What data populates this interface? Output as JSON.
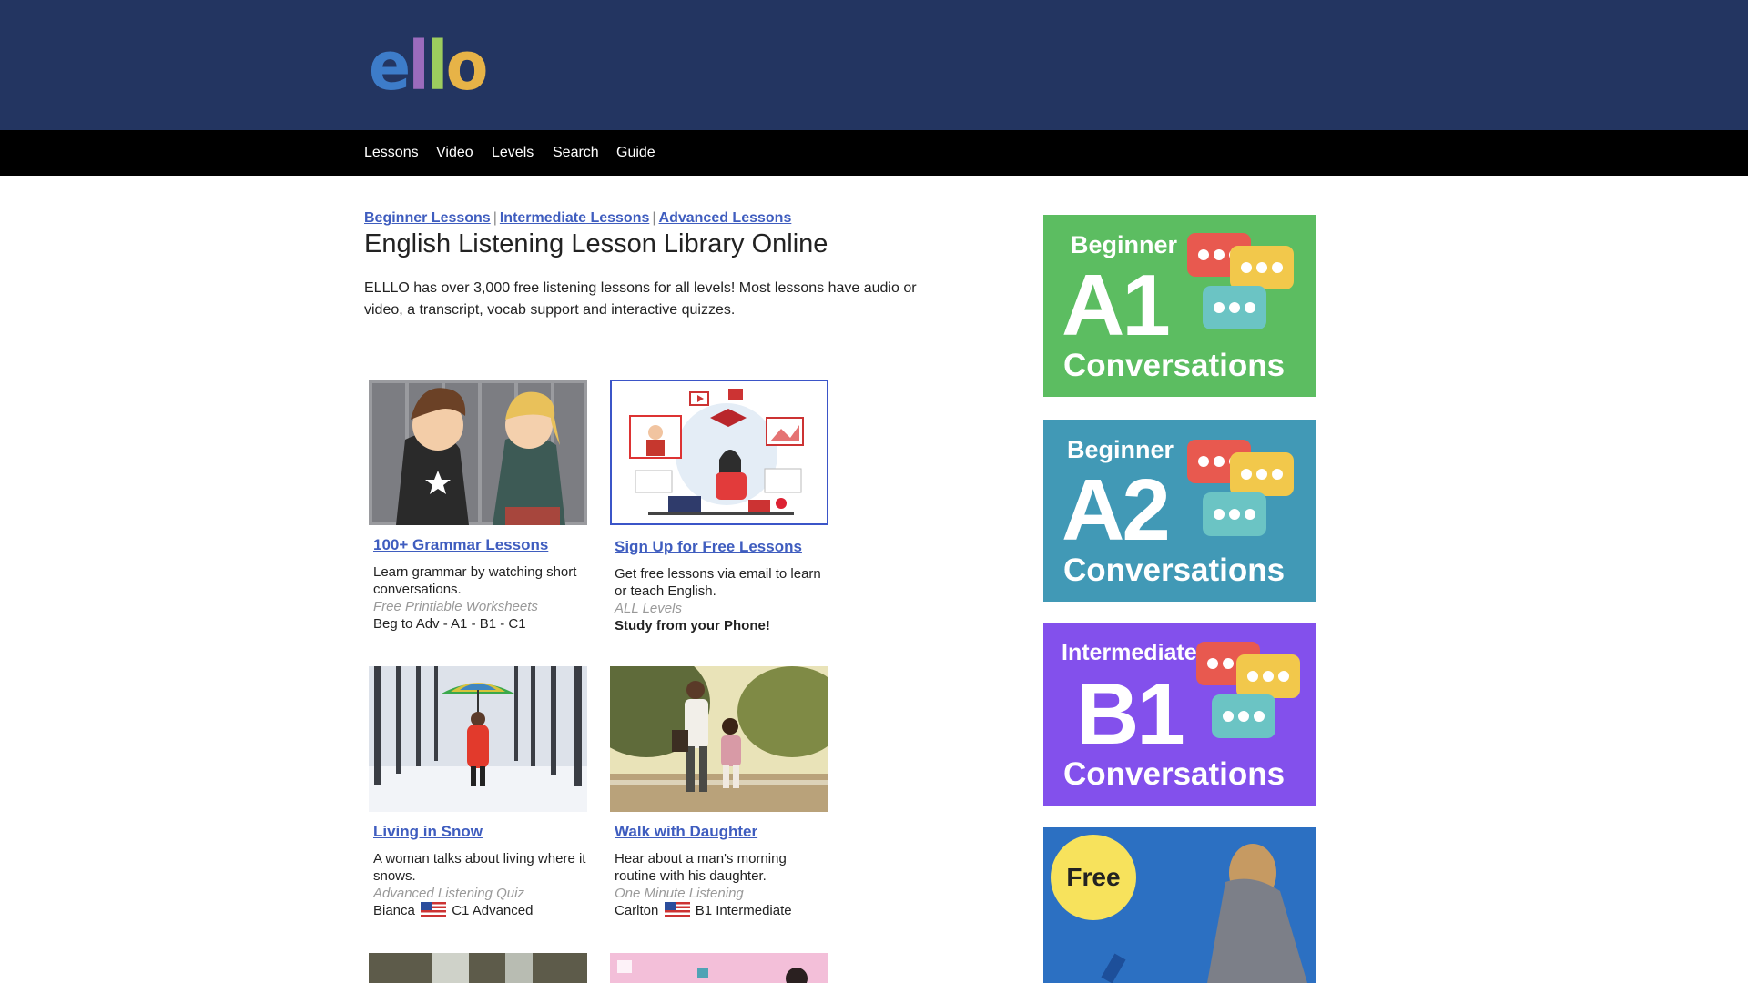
{
  "logo": {
    "text_e": "e",
    "text_l1": "l",
    "text_l2": "l",
    "text_o": "o"
  },
  "nav": [
    "Lessons",
    "Video",
    "Levels",
    "Search",
    "Guide"
  ],
  "breadcrumbs": {
    "beginner": "Beginner Lessons",
    "intermediate": "Intermediate Lessons",
    "advanced": "Advanced Lessons",
    "separator": "|"
  },
  "page_title": "English Listening Lesson Library Online",
  "intro": "ELLLO has over 3,000 free listening lessons for all levels! Most lessons have audio or video, a transcript, vocab support and interactive quizzes.",
  "cards": [
    {
      "title": "100+ Grammar Lessons",
      "desc": "Learn grammar by watching short conversations.",
      "tag": "Free Printiable Worksheets",
      "foot": "Beg to Adv - A1 - B1 - C1"
    },
    {
      "title": "Sign Up for Free Lessons",
      "desc": "Get free lessons via email to learn or teach English.",
      "tag": "ALL Levels",
      "foot": "Study from your Phone!"
    },
    {
      "title": "Living in Snow",
      "desc": "A woman talks about living where it snows.",
      "tag": "Advanced Listening Quiz",
      "speaker": "Bianca",
      "level": "C1 Advanced"
    },
    {
      "title": "Walk with Daughter",
      "desc": "Hear about a man's morning routine with his daughter.",
      "tag": "One Minute Listening",
      "speaker": "Carlton",
      "level": "B1 Intermediate"
    }
  ],
  "ads": [
    {
      "level": "Beginner",
      "code": "A1",
      "label": "Conversations",
      "color": "#5cbd61"
    },
    {
      "level": "Beginner",
      "code": "A2",
      "label": "Conversations",
      "color": "#4199b6"
    },
    {
      "level": "Intermediate",
      "code": "B1",
      "label": "Conversations",
      "color": "#8350ec"
    },
    {
      "badge": "Free",
      "color": "#2a6fbf"
    }
  ],
  "colors": {
    "header": "#233561",
    "nav": "#000000",
    "link": "#3f5dbf"
  }
}
